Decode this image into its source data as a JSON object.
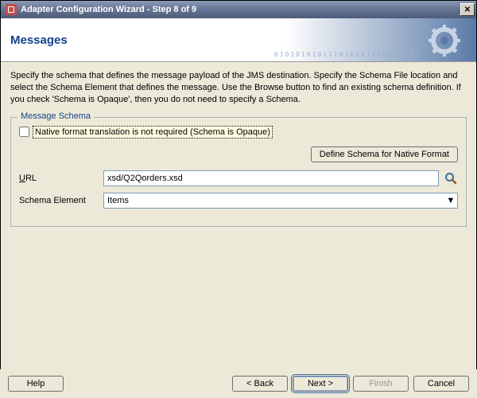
{
  "window": {
    "title": "Adapter Configuration Wizard - Step 8 of 9",
    "close_glyph": "✕"
  },
  "banner": {
    "title": "Messages",
    "bg_numbers": "010101010111010101010100101"
  },
  "intro": "Specify the schema that defines the message payload of the JMS destination.  Specify the Schema File location and select the Schema Element that defines the message. Use the Browse button to find an existing schema definition. If you check 'Schema is Opaque', then you do not need to specify a Schema.",
  "schema": {
    "legend": "Message Schema",
    "opaque_checkbox_label": "Native format translation is not required (Schema is Opaque)",
    "opaque_checked": false,
    "define_button": "Define Schema for Native Format",
    "url_label": "URL",
    "url_value": "xsd/Q2Qorders.xsd",
    "element_label": "Schema Element",
    "element_value": "Items"
  },
  "footer": {
    "help": "Help",
    "back": "< Back",
    "next": "Next >",
    "finish": "Finish",
    "cancel": "Cancel"
  }
}
